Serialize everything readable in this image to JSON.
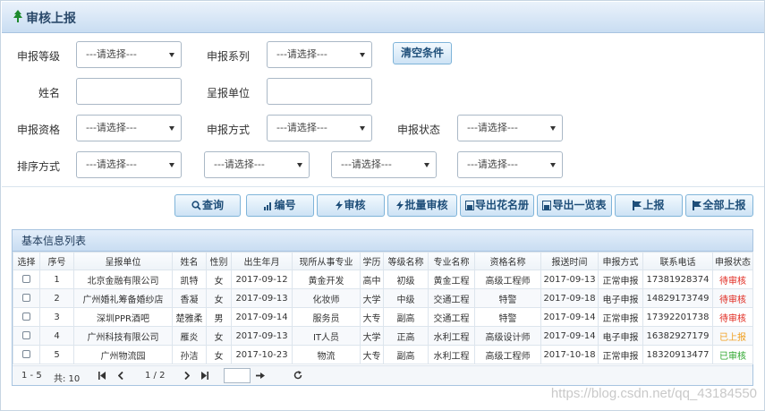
{
  "header": {
    "title": "审核上报",
    "icon": "tree-icon"
  },
  "filters": {
    "level_label": "申报等级",
    "level_value": "---请选择---",
    "series_label": "申报系列",
    "series_value": "---请选择---",
    "clear_label": "清空条件",
    "name_label": "姓名",
    "name_value": "",
    "unit_label": "呈报单位",
    "unit_value": "",
    "qualification_label": "申报资格",
    "qualification_value": "---请选择---",
    "method_label": "申报方式",
    "method_value": "---请选择---",
    "status_label": "申报状态",
    "status_value": "---请选择---",
    "sort_label": "排序方式",
    "sort1_value": "---请选择---",
    "sort2_value": "---请选择---",
    "sort3_value": "---请选择---",
    "sort4_value": "---请选择---"
  },
  "toolbar": {
    "query": "查询",
    "number": "编号",
    "audit": "审核",
    "batch_audit": "批量审核",
    "export_roster": "导出花名册",
    "export_list": "导出一览表",
    "report": "上报",
    "report_all": "全部上报"
  },
  "grid": {
    "title": "基本信息列表",
    "columns": [
      "选择",
      "序号",
      "呈报单位",
      "姓名",
      "性别",
      "出生年月",
      "现所从事专业",
      "学历",
      "等级名称",
      "专业名称",
      "资格名称",
      "报送时间",
      "申报方式",
      "联系电话",
      "申报状态"
    ],
    "rows": [
      {
        "no": "1",
        "unit": "北京金融有限公司",
        "name": "凯特",
        "sex": "女",
        "birth": "2017-09-12",
        "major": "黄金开发",
        "edu": "高中",
        "level": "初级",
        "spec": "黄金工程",
        "qual": "高级工程师",
        "time": "2017-09-13",
        "method": "正常申报",
        "phone": "17381928374",
        "status": "待审核",
        "status_color": "#e0261c"
      },
      {
        "no": "2",
        "unit": "广州婚礼筹备婚纱店",
        "name": "香凝",
        "sex": "女",
        "birth": "2017-09-13",
        "major": "化妆师",
        "edu": "大学",
        "level": "中级",
        "spec": "交通工程",
        "qual": "特警",
        "time": "2017-09-18",
        "method": "电子申报",
        "phone": "14829173749",
        "status": "待审核",
        "status_color": "#e0261c"
      },
      {
        "no": "3",
        "unit": "深圳PPR酒吧",
        "name": "楚雅柔",
        "sex": "男",
        "birth": "2017-09-14",
        "major": "服务员",
        "edu": "大专",
        "level": "副高",
        "spec": "交通工程",
        "qual": "特警",
        "time": "2017-09-14",
        "method": "正常申报",
        "phone": "17392201738",
        "status": "待审核",
        "status_color": "#e0261c"
      },
      {
        "no": "4",
        "unit": "广州科技有限公司",
        "name": "雁炎",
        "sex": "女",
        "birth": "2017-09-13",
        "major": "IT人员",
        "edu": "大学",
        "level": "正高",
        "spec": "水利工程",
        "qual": "高级设计师",
        "time": "2017-09-14",
        "method": "电子申报",
        "phone": "16382927179",
        "status": "已上报",
        "status_color": "#f0a020"
      },
      {
        "no": "5",
        "unit": "广州物流园",
        "name": "孙洁",
        "sex": "女",
        "birth": "2017-10-23",
        "major": "物流",
        "edu": "大专",
        "level": "副高",
        "spec": "水利工程",
        "qual": "高级工程师",
        "time": "2017-10-18",
        "method": "正常申报",
        "phone": "18320913477",
        "status": "已审核",
        "status_color": "#2aa52a"
      }
    ]
  },
  "pager": {
    "range": "1 - 5",
    "total": "共: 10",
    "page": "1 / 2",
    "page_input": ""
  },
  "watermark": "https://blog.csdn.net/qq_43184550"
}
